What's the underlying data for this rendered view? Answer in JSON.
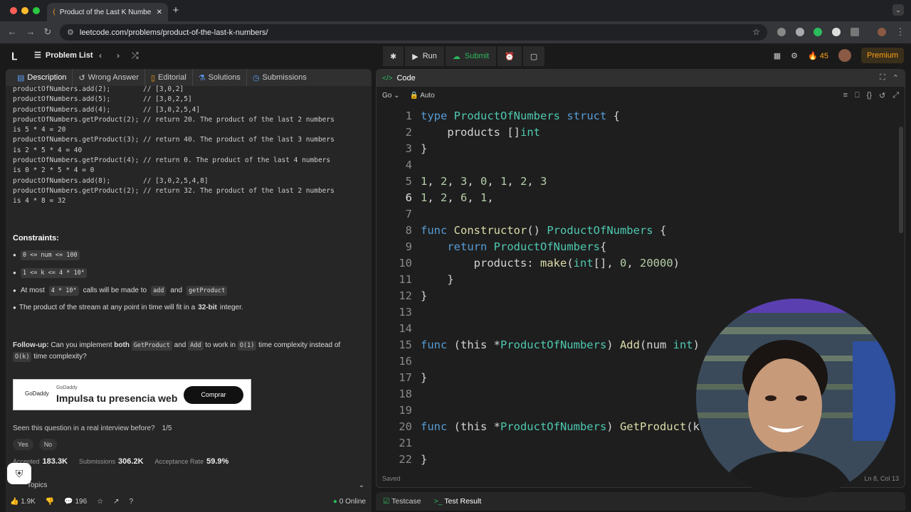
{
  "browser": {
    "tab_title": "Product of the Last K Numbe",
    "url": "leetcode.com/problems/product-of-the-last-k-numbers/"
  },
  "nav": {
    "problem_list": "Problem List",
    "run": "Run",
    "submit": "Submit",
    "streak": "45",
    "premium": "Premium"
  },
  "left_tabs": [
    {
      "label": "Description"
    },
    {
      "label": "Wrong Answer"
    },
    {
      "label": "Editorial"
    },
    {
      "label": "Solutions"
    },
    {
      "label": "Submissions"
    }
  ],
  "example_lines": [
    "productOfNumbers.add(2);        // [3,0,2]",
    "productOfNumbers.add(5);        // [3,0,2,5]",
    "productOfNumbers.add(4);        // [3,0,2,5,4]",
    "productOfNumbers.getProduct(2); // return 20. The product of the last 2 numbers",
    "is 5 * 4 = 20",
    "productOfNumbers.getProduct(3); // return 40. The product of the last 3 numbers",
    "is 2 * 5 * 4 = 40",
    "productOfNumbers.getProduct(4); // return 0. The product of the last 4 numbers",
    "is 0 * 2 * 5 * 4 = 0",
    "productOfNumbers.add(8);        // [3,0,2,5,4,8]",
    "productOfNumbers.getProduct(2); // return 32. The product of the last 2 numbers",
    "is 4 * 8 = 32"
  ],
  "constraints": {
    "heading": "Constraints:",
    "c1": "0 <= num <= 100",
    "c2": "1 <= k <= 4 * 10⁴",
    "c3_pre": "At most",
    "c3_chip": "4 * 10⁴",
    "c3_mid": "calls will be made to",
    "c3_add": "add",
    "c3_and": "and",
    "c3_get": "getProduct",
    "c4_pre": "The product of the stream at any point in time will fit in a",
    "c4_bold": "32-bit",
    "c4_post": "integer."
  },
  "followup": {
    "label": "Follow-up:",
    "t1": "Can you implement",
    "both": "both",
    "gp": "GetProduct",
    "and": "and",
    "add": "Add",
    "t2": "to work in",
    "o1": "O(1)",
    "t3": "time complexity instead of",
    "ok": "O(k)",
    "t4": "time complexity?"
  },
  "ad": {
    "brand": "GoDaddy",
    "small": "GoDaddy",
    "headline": "Impulsa tu presencia web",
    "button": "Comprar"
  },
  "interview": {
    "question": "Seen this question in a real interview before?",
    "count": "1/5",
    "yes": "Yes",
    "no": "No"
  },
  "stats": {
    "accepted_label": "Accepted",
    "accepted": "183.3K",
    "submissions_label": "Submissions",
    "submissions": "306.2K",
    "rate_label": "Acceptance Rate",
    "rate": "59.9%"
  },
  "topics": "Topics",
  "bottom": {
    "likes": "1.9K",
    "comments": "196",
    "online": "0 Online"
  },
  "editor": {
    "title": "Code",
    "language": "Go",
    "mode": "Auto",
    "saved": "Saved",
    "cursor": "Ln 8, Col 13"
  },
  "testbar": {
    "testcase": "Testcase",
    "result": "Test Result"
  }
}
